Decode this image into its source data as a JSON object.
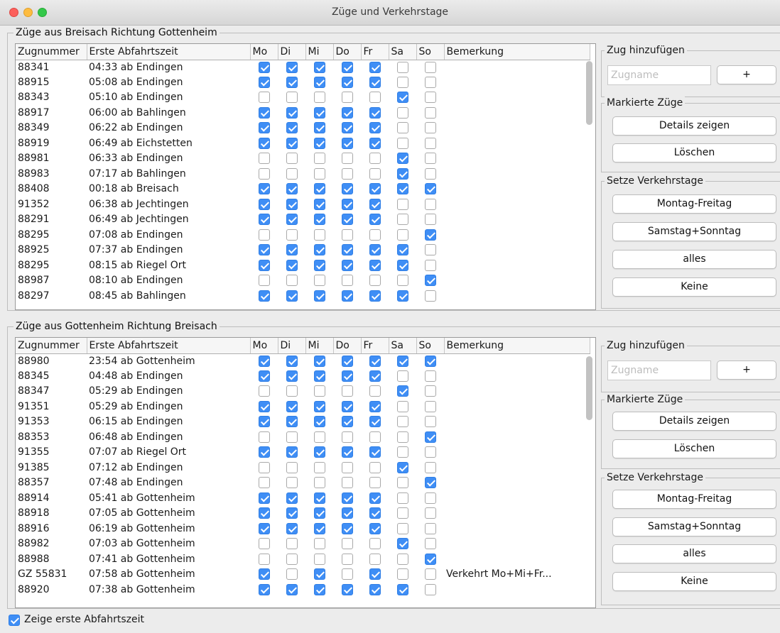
{
  "window": {
    "title": "Züge und Verkehrstage"
  },
  "columns": [
    "Zugnummer",
    "Erste Abfahrtszeit",
    "Mo",
    "Di",
    "Mi",
    "Do",
    "Fr",
    "Sa",
    "So",
    "Bemerkung"
  ],
  "section1": {
    "title": "Züge aus Breisach Richtung Gottenheim",
    "rows": [
      {
        "nr": "88341",
        "zeit": "04:33 ab Endingen",
        "days": [
          1,
          1,
          1,
          1,
          1,
          0,
          0
        ],
        "note": ""
      },
      {
        "nr": "88915",
        "zeit": "05:08 ab Endingen",
        "days": [
          1,
          1,
          1,
          1,
          1,
          0,
          0
        ],
        "note": ""
      },
      {
        "nr": "88343",
        "zeit": "05:10 ab Endingen",
        "days": [
          0,
          0,
          0,
          0,
          0,
          1,
          0
        ],
        "note": ""
      },
      {
        "nr": "88917",
        "zeit": "06:00 ab Bahlingen",
        "days": [
          1,
          1,
          1,
          1,
          1,
          0,
          0
        ],
        "note": ""
      },
      {
        "nr": "88349",
        "zeit": "06:22 ab Endingen",
        "days": [
          1,
          1,
          1,
          1,
          1,
          0,
          0
        ],
        "note": ""
      },
      {
        "nr": "88919",
        "zeit": "06:49 ab Eichstetten",
        "days": [
          1,
          1,
          1,
          1,
          1,
          0,
          0
        ],
        "note": ""
      },
      {
        "nr": "88981",
        "zeit": "06:33 ab Endingen",
        "days": [
          0,
          0,
          0,
          0,
          0,
          1,
          0
        ],
        "note": ""
      },
      {
        "nr": "88983",
        "zeit": "07:17 ab Bahlingen",
        "days": [
          0,
          0,
          0,
          0,
          0,
          1,
          0
        ],
        "note": ""
      },
      {
        "nr": "88408",
        "zeit": "00:18 ab Breisach",
        "days": [
          1,
          1,
          1,
          1,
          1,
          1,
          1
        ],
        "note": ""
      },
      {
        "nr": "91352",
        "zeit": "06:38 ab Jechtingen",
        "days": [
          1,
          1,
          1,
          1,
          1,
          0,
          0
        ],
        "note": ""
      },
      {
        "nr": "88291",
        "zeit": "06:49 ab Jechtingen",
        "days": [
          1,
          1,
          1,
          1,
          1,
          0,
          0
        ],
        "note": ""
      },
      {
        "nr": "88295",
        "zeit": "07:08 ab Endingen",
        "days": [
          0,
          0,
          0,
          0,
          0,
          0,
          1
        ],
        "note": ""
      },
      {
        "nr": "88925",
        "zeit": "07:37 ab Endingen",
        "days": [
          1,
          1,
          1,
          1,
          1,
          1,
          0
        ],
        "note": ""
      },
      {
        "nr": "88295",
        "zeit": "08:15 ab Riegel Ort",
        "days": [
          1,
          1,
          1,
          1,
          1,
          1,
          0
        ],
        "note": ""
      },
      {
        "nr": "88987",
        "zeit": "08:10 ab Endingen",
        "days": [
          0,
          0,
          0,
          0,
          0,
          0,
          1
        ],
        "note": ""
      },
      {
        "nr": "88297",
        "zeit": "08:45 ab Bahlingen",
        "days": [
          1,
          1,
          1,
          1,
          1,
          1,
          0
        ],
        "note": ""
      }
    ]
  },
  "section2": {
    "title": "Züge aus Gottenheim Richtung Breisach",
    "rows": [
      {
        "nr": "88980",
        "zeit": "23:54 ab Gottenheim",
        "days": [
          1,
          1,
          1,
          1,
          1,
          1,
          1
        ],
        "note": ""
      },
      {
        "nr": "88345",
        "zeit": "04:48 ab Endingen",
        "days": [
          1,
          1,
          1,
          1,
          1,
          0,
          0
        ],
        "note": ""
      },
      {
        "nr": "88347",
        "zeit": "05:29 ab Endingen",
        "days": [
          0,
          0,
          0,
          0,
          0,
          1,
          0
        ],
        "note": ""
      },
      {
        "nr": "91351",
        "zeit": "05:29 ab Endingen",
        "days": [
          1,
          1,
          1,
          1,
          1,
          0,
          0
        ],
        "note": ""
      },
      {
        "nr": "91353",
        "zeit": "06:15 ab Endingen",
        "days": [
          1,
          1,
          1,
          1,
          1,
          0,
          0
        ],
        "note": ""
      },
      {
        "nr": "88353",
        "zeit": "06:48 ab Endingen",
        "days": [
          0,
          0,
          0,
          0,
          0,
          0,
          1
        ],
        "note": ""
      },
      {
        "nr": "91355",
        "zeit": "07:07 ab Riegel Ort",
        "days": [
          1,
          1,
          1,
          1,
          1,
          0,
          0
        ],
        "note": ""
      },
      {
        "nr": "91385",
        "zeit": "07:12 ab Endingen",
        "days": [
          0,
          0,
          0,
          0,
          0,
          1,
          0
        ],
        "note": ""
      },
      {
        "nr": "88357",
        "zeit": "07:48 ab Endingen",
        "days": [
          0,
          0,
          0,
          0,
          0,
          0,
          1
        ],
        "note": ""
      },
      {
        "nr": "88914",
        "zeit": "05:41 ab Gottenheim",
        "days": [
          1,
          1,
          1,
          1,
          1,
          0,
          0
        ],
        "note": ""
      },
      {
        "nr": "88918",
        "zeit": "07:05 ab Gottenheim",
        "days": [
          1,
          1,
          1,
          1,
          1,
          0,
          0
        ],
        "note": ""
      },
      {
        "nr": "88916",
        "zeit": "06:19 ab Gottenheim",
        "days": [
          1,
          1,
          1,
          1,
          1,
          0,
          0
        ],
        "note": ""
      },
      {
        "nr": "88982",
        "zeit": "07:03 ab Gottenheim",
        "days": [
          0,
          0,
          0,
          0,
          0,
          1,
          0
        ],
        "note": ""
      },
      {
        "nr": "88988",
        "zeit": "07:41 ab Gottenheim",
        "days": [
          0,
          0,
          0,
          0,
          0,
          0,
          1
        ],
        "note": ""
      },
      {
        "nr": "GZ 55831",
        "zeit": "07:58 ab Gottenheim",
        "days": [
          1,
          0,
          1,
          0,
          1,
          0,
          0
        ],
        "note": "Verkehrt Mo+Mi+Fr..."
      },
      {
        "nr": "88920",
        "zeit": "07:38 ab Gottenheim",
        "days": [
          1,
          1,
          1,
          1,
          1,
          1,
          0
        ],
        "note": ""
      }
    ]
  },
  "sidebar": {
    "add_group": "Zug hinzufügen",
    "input_placeholder": "Zugname",
    "add_button": "+",
    "marked_group": "Markierte Züge",
    "details_button": "Details zeigen",
    "delete_button": "Löschen",
    "days_group": "Setze Verkehrstage",
    "weekdays_button": "Montag-Freitag",
    "weekend_button": "Samstag+Sonntag",
    "all_button": "alles",
    "none_button": "Keine"
  },
  "footer": {
    "checkbox_label": "Zeige erste Abfahrtszeit",
    "checked": true
  },
  "colors": {
    "accent": "#3f8ef5",
    "window_bg": "#ececec"
  }
}
